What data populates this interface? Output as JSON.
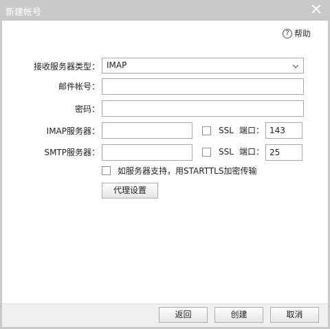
{
  "window": {
    "title": "新建帐号"
  },
  "help": {
    "icon": "question-circle-icon",
    "label": "帮助"
  },
  "form": {
    "server_type_label": "接收服务器类型：",
    "server_type_value": "IMAP",
    "account_label": "邮件帐号：",
    "account_value": "",
    "password_label": "密码：",
    "password_value": "",
    "imap_label": "IMAP服务器：",
    "imap_value": "",
    "imap_ssl_label": "SSL",
    "imap_ssl_checked": false,
    "imap_port_label": "端口：",
    "imap_port_value": "143",
    "smtp_label": "SMTP服务器：",
    "smtp_value": "",
    "smtp_ssl_label": "SSL",
    "smtp_ssl_checked": false,
    "smtp_port_label": "端口：",
    "smtp_port_value": "25",
    "starttls_label": "如服务器支持，用STARTTLS加密传输",
    "starttls_checked": false,
    "proxy_button": "代理设置"
  },
  "footer": {
    "back_button": "返回",
    "create_button": "创建",
    "cancel_button": "取消"
  }
}
